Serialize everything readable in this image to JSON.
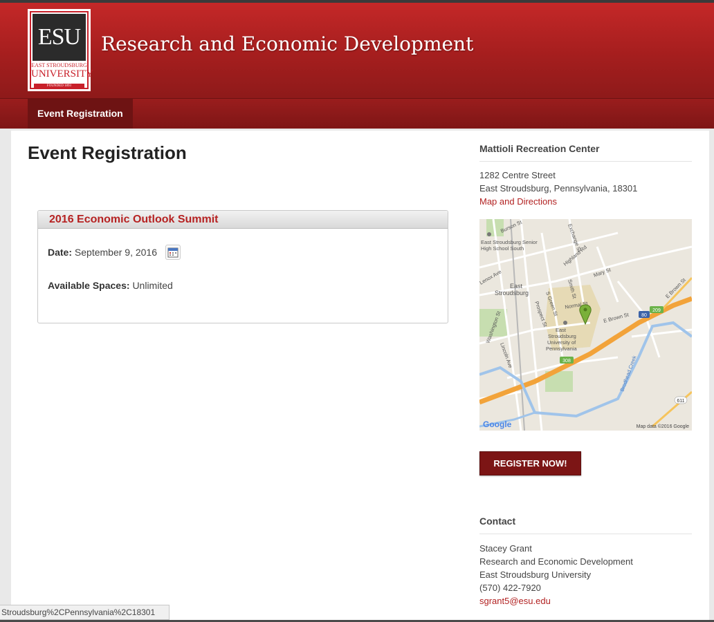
{
  "header": {
    "site_title": "Research and Economic Development",
    "logo": {
      "mark": "ESU",
      "line1": "EAST STROUDSBURG",
      "line2": "UNIVERSITY",
      "line3": "FOUNDED 1893"
    }
  },
  "nav": {
    "items": [
      {
        "label": "Event Registration"
      }
    ]
  },
  "main": {
    "page_title": "Event Registration",
    "event": {
      "title": "2016 Economic Outlook Summit",
      "date_label": "Date:",
      "date_value": "September 9, 2016",
      "spaces_label": "Available Spaces:",
      "spaces_value": "Unlimited"
    }
  },
  "sidebar": {
    "location": {
      "heading": "Mattioli Recreation Center",
      "street": "1282 Centre Street",
      "city_line": "East Stroudsburg, Pennsylvania, 18301",
      "map_link": "Map and Directions"
    },
    "map": {
      "labels": {
        "burson": "Burson St",
        "exchange": "Exchange St",
        "highland": "Highland Rd",
        "school1": "East Stroudsburg Senior",
        "school2": "High School South",
        "lenox": "Lenox Ave",
        "town1": "East",
        "town2": "Stroudsburg",
        "mary": "Mary St",
        "smith": "Smith St",
        "green": "S Green St",
        "normal": "Normal St",
        "ebrown": "E Brown St",
        "ebrown2": "E Brown St",
        "prospect": "Prospect St",
        "washington": "Washington St",
        "lincoln": "Lincoln Ave",
        "univ1": "East",
        "univ2": "Stroudsburg",
        "univ3": "University of",
        "univ4": "Pennsylvania",
        "brodhead": "Brodhead Creek",
        "route80": "80",
        "route209": "209",
        "route308": "308",
        "route611": "611",
        "google": "Google",
        "mapdata": "Map data ©2016 Google"
      }
    },
    "register_label": "REGISTER NOW!",
    "contact": {
      "heading": "Contact",
      "name": "Stacey Grant",
      "dept": "Research and Economic Development",
      "org": "East Stroudsburg University",
      "phone": "(570) 422-7920",
      "email": "sgrant5@esu.edu"
    }
  },
  "statusbar": {
    "text": "Stroudsburg%2CPennsylvania%2C18301"
  },
  "colors": {
    "brand_red": "#a51e1e",
    "nav_active": "#6e1313",
    "link_red": "#b22222",
    "register_bg": "#7c1515"
  }
}
